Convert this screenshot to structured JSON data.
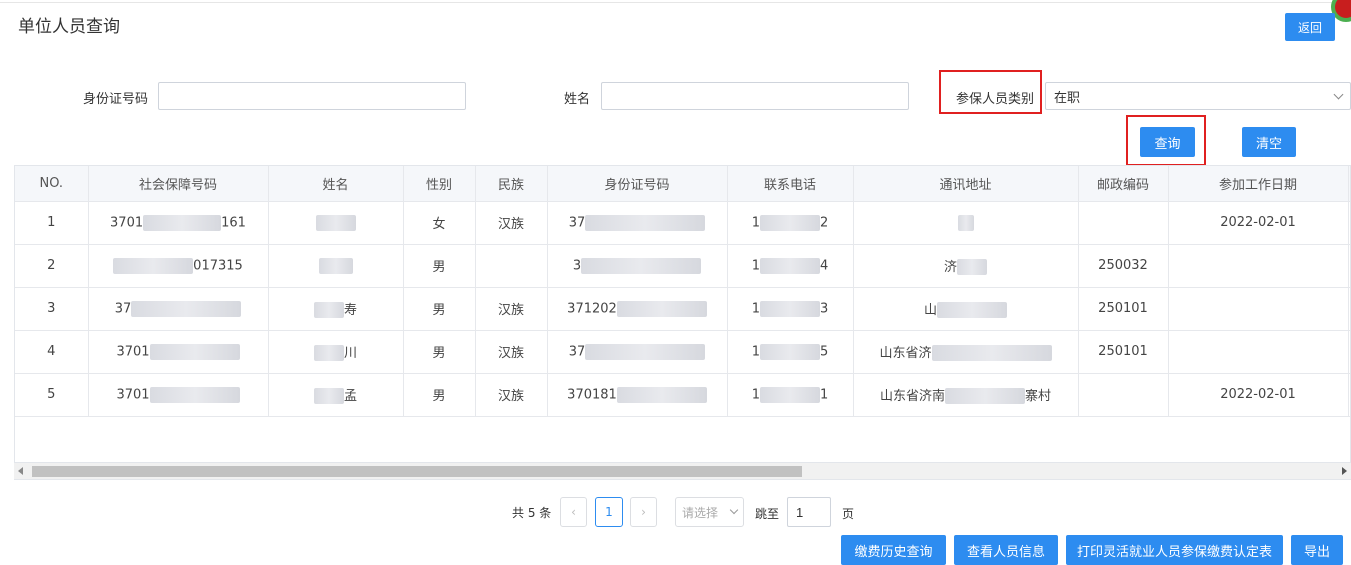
{
  "page": {
    "title": "单位人员查询"
  },
  "toolbar": {
    "back_label": "返回"
  },
  "filters": {
    "id_label": "身份证号码",
    "id_value": "",
    "name_label": "姓名",
    "name_value": "",
    "type_label": "参保人员类别",
    "type_value": "在职"
  },
  "actions": {
    "search_label": "查询",
    "clear_label": "清空"
  },
  "table": {
    "headers": [
      "NO.",
      "社会保障号码",
      "姓名",
      "性别",
      "民族",
      "身份证号码",
      "联系电话",
      "通讯地址",
      "邮政编码",
      "参加工作日期"
    ],
    "rows": [
      {
        "no": "1",
        "ssn": "3701",
        "ssn_tail": "161",
        "name_tail": "",
        "gender": "女",
        "ethnic": "汉族",
        "idno": "37",
        "phone": "1",
        "phone_tail": "2",
        "addr": "",
        "addr_tail": "",
        "zip": "",
        "date": "2022-02-01"
      },
      {
        "no": "2",
        "ssn": "",
        "ssn_tail": "017315",
        "name_tail": "",
        "gender": "男",
        "ethnic": "",
        "idno": "3",
        "phone": "1",
        "phone_tail": "4",
        "addr": "济",
        "addr_tail": "",
        "zip": "250032",
        "date": ""
      },
      {
        "no": "3",
        "ssn": "37",
        "ssn_tail": "",
        "name_tail": "寿",
        "gender": "男",
        "ethnic": "汉族",
        "idno": "371202",
        "phone": "1",
        "phone_tail": "3",
        "addr": "山",
        "addr_tail": "",
        "zip": "250101",
        "date": ""
      },
      {
        "no": "4",
        "ssn": "3701",
        "ssn_tail": "",
        "name_tail": "川",
        "gender": "男",
        "ethnic": "汉族",
        "idno": "37",
        "phone": "1",
        "phone_tail": "5",
        "addr": "山东省济",
        "addr_tail": "",
        "zip": "250101",
        "date": ""
      },
      {
        "no": "5",
        "ssn": "3701",
        "ssn_tail": "",
        "name_tail": "孟",
        "gender": "男",
        "ethnic": "汉族",
        "idno": "370181",
        "phone": "1",
        "phone_tail": "1",
        "addr": "山东省济南",
        "addr_tail": "寨村",
        "zip": "",
        "date": "2022-02-01"
      }
    ]
  },
  "pagination": {
    "total_label": "共 5 条",
    "current_page": "1",
    "page_size_placeholder": "请选择",
    "jump_label": "跳至",
    "jump_value": "1",
    "page_suffix": "页"
  },
  "bottom_actions": {
    "history_label": "缴费历史查询",
    "view_person_label": "查看人员信息",
    "print_label": "打印灵活就业人员参保缴费认定表",
    "export_label": "导出"
  },
  "colors": {
    "primary": "#2d8cf0",
    "highlight_box": "#e02020"
  }
}
